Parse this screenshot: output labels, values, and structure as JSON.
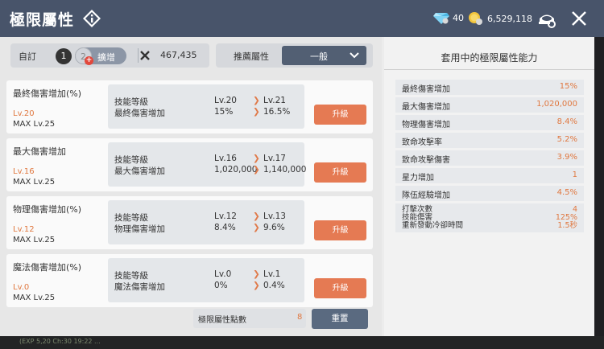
{
  "header": {
    "title": "極限屬性",
    "info_icon": "info-icon",
    "gems": "40",
    "gold": "6,529,118",
    "colors": {
      "bg": "#48546a"
    }
  },
  "toolbar": {
    "custom_label": "自訂",
    "slot_1": "1",
    "slot_2": "2",
    "expand_label": "擴增",
    "expand_cost": "467,435",
    "recommend_label": "推薦屬性",
    "recommend_value": "一般"
  },
  "attributes": [
    {
      "name": "最終傷害增加(%)",
      "level": "Lv.20",
      "max": "MAX Lv.25",
      "label1": "技能等級",
      "label2": "最終傷害增加",
      "cur1": "Lv.20",
      "cur2": "15%",
      "next1": "Lv.21",
      "next2": "16.5%",
      "upgrade": "升級"
    },
    {
      "name": "最大傷害增加",
      "level": "Lv.16",
      "max": "MAX Lv.25",
      "label1": "技能等級",
      "label2": "最大傷害增加",
      "cur1": "Lv.16",
      "cur2": "1,020,000",
      "next1": "Lv.17",
      "next2": "1,140,000",
      "upgrade": "升級"
    },
    {
      "name": "物理傷害增加(%)",
      "level": "Lv.12",
      "max": "MAX Lv.25",
      "label1": "技能等級",
      "label2": "物理傷害增加",
      "cur1": "Lv.12",
      "cur2": "8.4%",
      "next1": "Lv.13",
      "next2": "9.6%",
      "upgrade": "升級"
    },
    {
      "name": "魔法傷害增加(%)",
      "level": "Lv.0",
      "max": "MAX Lv.25",
      "label1": "技能等級",
      "label2": "魔法傷害增加",
      "cur1": "Lv.0",
      "cur2": "0%",
      "next1": "Lv.1",
      "next2": "0.4%",
      "upgrade": "升級"
    }
  ],
  "footer": {
    "points_label": "極限屬性點數",
    "points_value": "8",
    "reset_label": "重置"
  },
  "summary": {
    "title": "套用中的極限屬性能力",
    "rows": [
      {
        "label": "最終傷害增加",
        "value": "15%"
      },
      {
        "label": "最大傷害增加",
        "value": "1,020,000"
      },
      {
        "label": "物理傷害增加",
        "value": "8.4%"
      },
      {
        "label": "致命攻擊率",
        "value": "5.2%"
      },
      {
        "label": "致命攻擊傷害",
        "value": "3.9%"
      },
      {
        "label": "星力增加",
        "value": "1"
      },
      {
        "label": "隊伍經驗增加",
        "value": "4.5%"
      }
    ],
    "multi": [
      {
        "label": "打擊次數",
        "value": "4"
      },
      {
        "label": "技能傷害",
        "value": "125%"
      },
      {
        "label": "重新發動冷卻時間",
        "value": "1.5秒"
      }
    ]
  },
  "bottom_strip": {
    "text": "(EXP 5,20 Ch:30 19:22 ..."
  }
}
